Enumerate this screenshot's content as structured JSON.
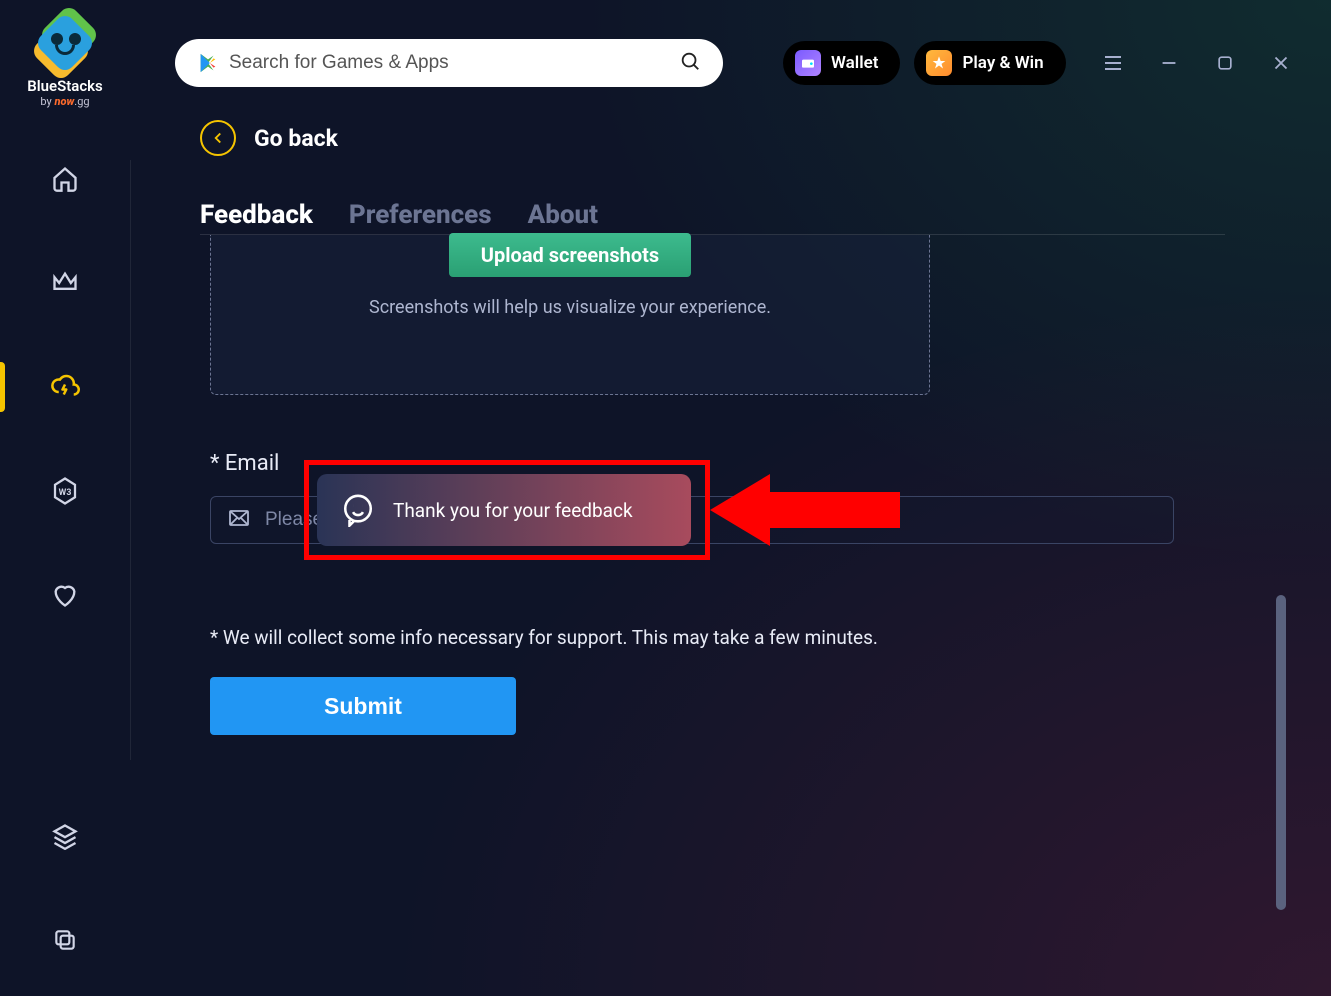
{
  "brand": {
    "name": "BlueStacks",
    "sub_prefix": "by",
    "sub_brand": "now",
    "sub_suffix": ".gg"
  },
  "search": {
    "placeholder": "Search for Games & Apps"
  },
  "top_buttons": {
    "wallet": "Wallet",
    "playwin": "Play & Win"
  },
  "go_back": "Go back",
  "tabs": {
    "feedback": "Feedback",
    "preferences": "Preferences",
    "about": "About"
  },
  "upload": {
    "button": "Upload screenshots",
    "hint": "Screenshots will help us visualize your experience."
  },
  "email": {
    "label": "* Email",
    "placeholder": "Please enter your email"
  },
  "disclaimer": "* We will collect some info necessary for support. This may take a few minutes.",
  "submit": "Submit",
  "toast": "Thank you for your feedback",
  "colors": {
    "accent": "#f5c400",
    "primary": "#2196f3",
    "green": "#2aa073"
  }
}
